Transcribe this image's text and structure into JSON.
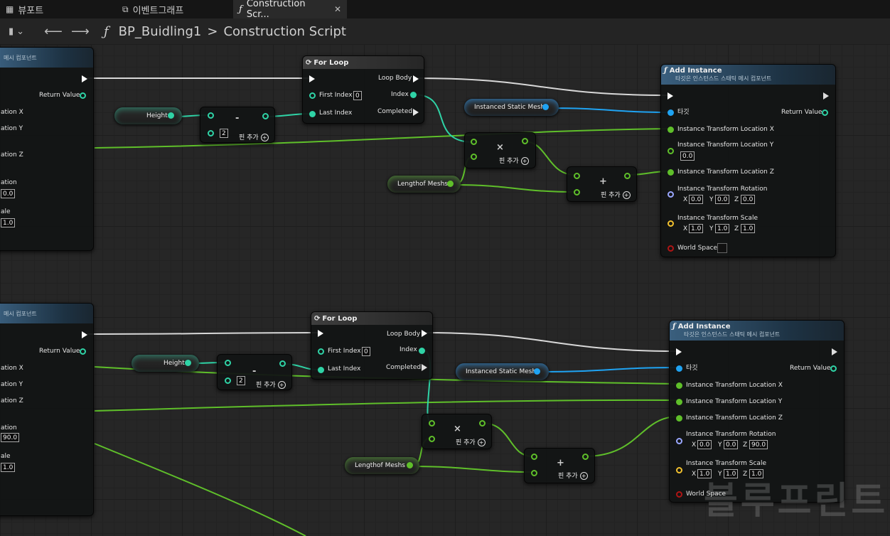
{
  "tabs": [
    {
      "label": "뷰포트",
      "icon": "grid-icon"
    },
    {
      "label": "이벤트그래프",
      "icon": "graph-icon"
    },
    {
      "label": "Construction Scr...",
      "icon": "function-icon",
      "active": true
    }
  ],
  "breadcrumb": {
    "root": "BP_Buidling1",
    "sep": ">",
    "current": "Construction Script"
  },
  "watermark": "블루프린트",
  "colors": {
    "exec": "#ffffff",
    "integer": "#2fd3a6",
    "float": "#7ad92a",
    "object": "#1fa3f2",
    "rotator": "#9aa7ff",
    "vector": "#f2c12e",
    "bool": "#b01515"
  },
  "graph": {
    "partial_node": {
      "subtitle": "메시 컴포넌트",
      "return_value": "Return Value",
      "pins": [
        "ation X",
        "ation Y",
        "ation Z",
        "ation",
        "ale"
      ],
      "values_1": [
        "0.0",
        "1.0"
      ],
      "values_2": [
        "90.0",
        "1.0"
      ]
    },
    "for_loop": {
      "title": "For Loop",
      "loop_body": "Loop Body",
      "first_index": "First Index",
      "first_index_value": "0",
      "index": "Index",
      "last_index": "Last Index",
      "completed": "Completed"
    },
    "height": "Height",
    "length_meshs": "Lengthof Meshs",
    "instanced_static_mesh": "Instanced Static Mesh",
    "subtract": {
      "symbol": "-",
      "value": "2",
      "add_pin": "핀 추가"
    },
    "multiply": {
      "symbol": "×",
      "add_pin": "핀 추가"
    },
    "add": {
      "symbol": "+",
      "add_pin": "핀 추가"
    },
    "add_instance": {
      "title": "Add Instance",
      "subtitle": "타깃은 인스턴스드 스태틱 메시 컴포넌트",
      "target": "타깃",
      "return_value": "Return Value",
      "loc_x": "Instance Transform Location X",
      "loc_y": "Instance Transform Location Y",
      "loc_z": "Instance Transform Location Z",
      "rotation": "Instance Transform Rotation",
      "scale": "Instance Transform Scale",
      "world_space": "World Space",
      "x": "X",
      "y": "Y",
      "z": "Z"
    },
    "upper": {
      "loc_y_value": "0.0",
      "rotation": [
        "0.0",
        "0.0",
        "0.0"
      ],
      "scale": [
        "1.0",
        "1.0",
        "1.0"
      ]
    },
    "lower": {
      "rotation": [
        "0.0",
        "0.0",
        "90.0"
      ],
      "scale": [
        "1.0",
        "1.0",
        "1.0"
      ]
    }
  }
}
